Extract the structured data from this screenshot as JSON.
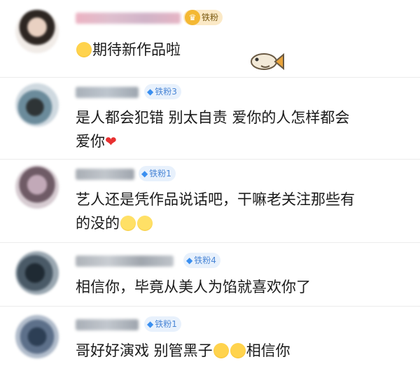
{
  "comments": [
    {
      "badge": "铁粉",
      "badge_type": "gold",
      "text": "期待新作品啦",
      "leading_emoji": "crying-face-emoji",
      "trailing_sticker": "fish-sticker"
    },
    {
      "badge": "铁粉3",
      "badge_type": "blue",
      "text_line1": "是人都会犯错 别太自责 爱你的人怎样都会",
      "text_line2": "爱你",
      "trailing_emoji": "red-heart-emoji"
    },
    {
      "badge": "铁粉1",
      "badge_type": "blue",
      "text_line1": "艺人还是凭作品说话吧，干嘛老关注那些有",
      "text_line2": "的没的",
      "trailing_emoji": "smile-emoji"
    },
    {
      "badge": "铁粉4",
      "badge_type": "blue",
      "text": "相信你，毕竟从美人为馅就喜欢你了"
    },
    {
      "badge": "铁粉1",
      "badge_type": "blue",
      "text_part1": "哥好好演戏 别管黑子",
      "text_part2": "相信你",
      "inline_emoji": "crying-face-emoji"
    }
  ],
  "colors": {
    "badge_blue_bg": "#e8f1fc",
    "badge_blue_text": "#4a86d6",
    "badge_gold_bg": "#fbe9c6",
    "heart": "#e83030",
    "divider": "#ececec"
  }
}
